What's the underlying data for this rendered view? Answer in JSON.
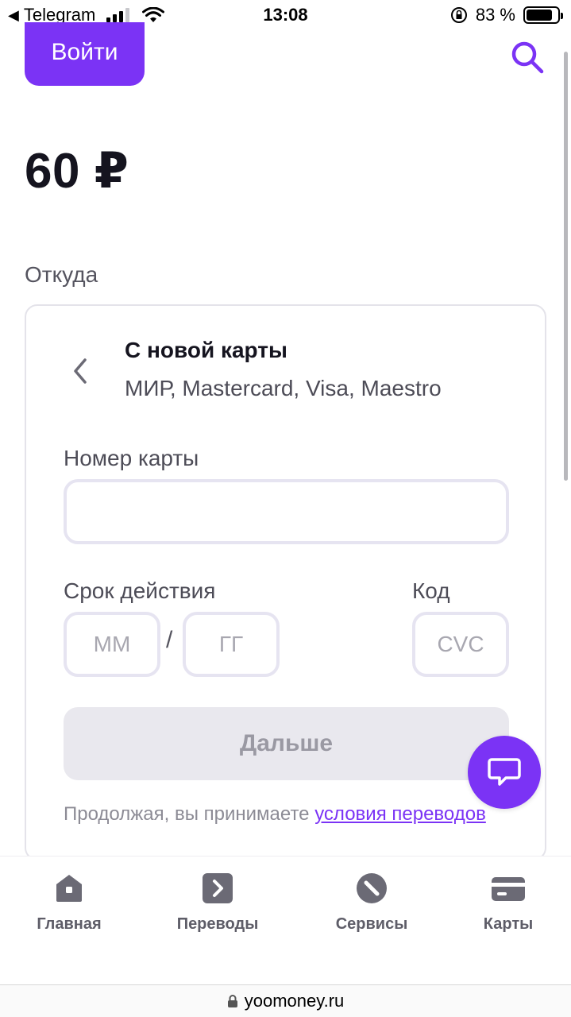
{
  "status_bar": {
    "back_app": "Telegram",
    "time": "13:08",
    "battery_percent": "83 %",
    "battery_level": 0.83,
    "signal_bars": 3,
    "icons": [
      "back-arrow-icon",
      "signal-icon",
      "wifi-icon",
      "orientation-lock-icon",
      "battery-icon"
    ]
  },
  "header": {
    "login_label": "Войти",
    "search_icon": "search-icon"
  },
  "payment": {
    "amount": "60 ₽",
    "from_label": "Откуда"
  },
  "card_form": {
    "title": "С новой карты",
    "subtitle": "МИР, Mastercard, Visa, Maestro",
    "card_number_label": "Номер карты",
    "card_number_value": "",
    "expiry_label": "Срок действия",
    "month_placeholder": "ММ",
    "year_placeholder": "ГГ",
    "separator": "/",
    "code_label": "Код",
    "cvc_placeholder": "CVC",
    "next_label": "Дальше",
    "terms_text": "Продолжая, вы принимаете ",
    "terms_link": "условия переводов"
  },
  "colors": {
    "accent": "#7b33f5",
    "text": "#15141f",
    "muted": "#4d4c57",
    "disabled_bg": "#e9e8ee",
    "input_border": "#e6e4f1",
    "nav_icon": "#6b6a75"
  },
  "bottom_nav": {
    "items": [
      {
        "label": "Главная",
        "icon": "home-icon"
      },
      {
        "label": "Переводы",
        "icon": "transfer-icon"
      },
      {
        "label": "Сервисы",
        "icon": "compass-icon"
      },
      {
        "label": "Карты",
        "icon": "card-icon"
      }
    ]
  },
  "browser": {
    "url": "yoomoney.ru",
    "lock_icon": "lock-icon"
  }
}
